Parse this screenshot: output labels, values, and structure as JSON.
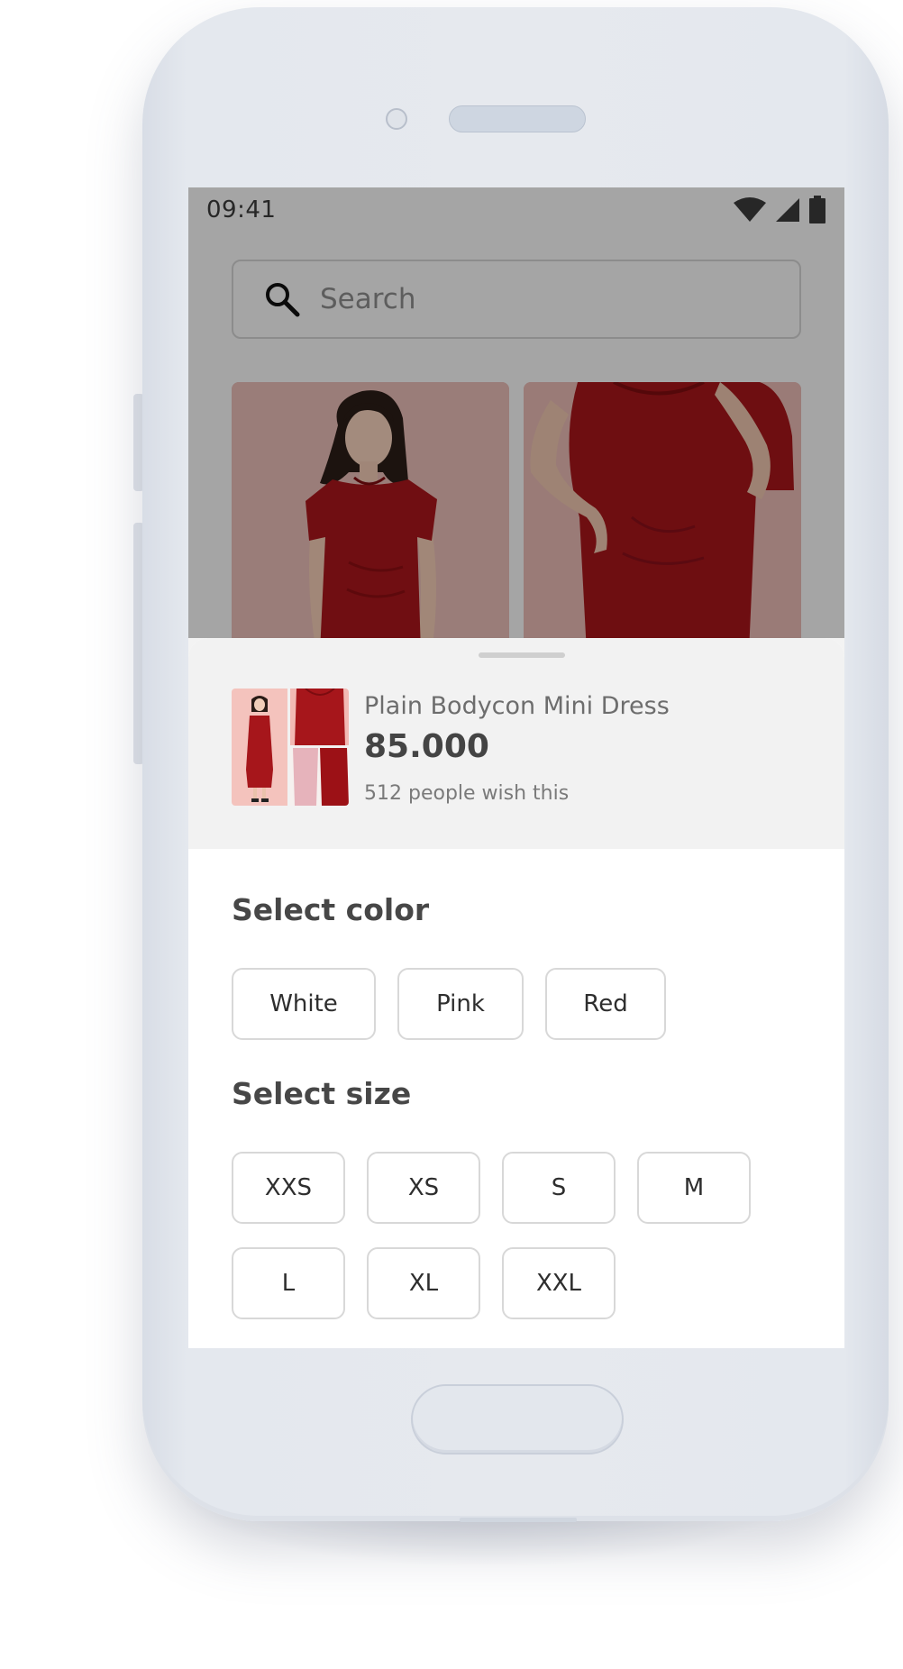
{
  "status_bar": {
    "time": "09:41"
  },
  "search": {
    "placeholder": "Search"
  },
  "product": {
    "name": "Plain Bodycon Mini Dress",
    "price": "85.000",
    "wish_count": "512 people wish this"
  },
  "color_section": {
    "title": "Select color",
    "options": [
      "White",
      "Pink",
      "Red"
    ]
  },
  "size_section": {
    "title": "Select size",
    "options": [
      "XXS",
      "XS",
      "S",
      "M",
      "L",
      "XL",
      "XXL"
    ]
  },
  "colors": {
    "dress_red": "#9c1116",
    "backdrop_pink": "#e2b5b0",
    "sheet_bg": "#ffffff",
    "header_bg": "#f2f2f2"
  },
  "icons": [
    "search-icon",
    "wifi-icon",
    "signal-icon",
    "battery-icon"
  ]
}
